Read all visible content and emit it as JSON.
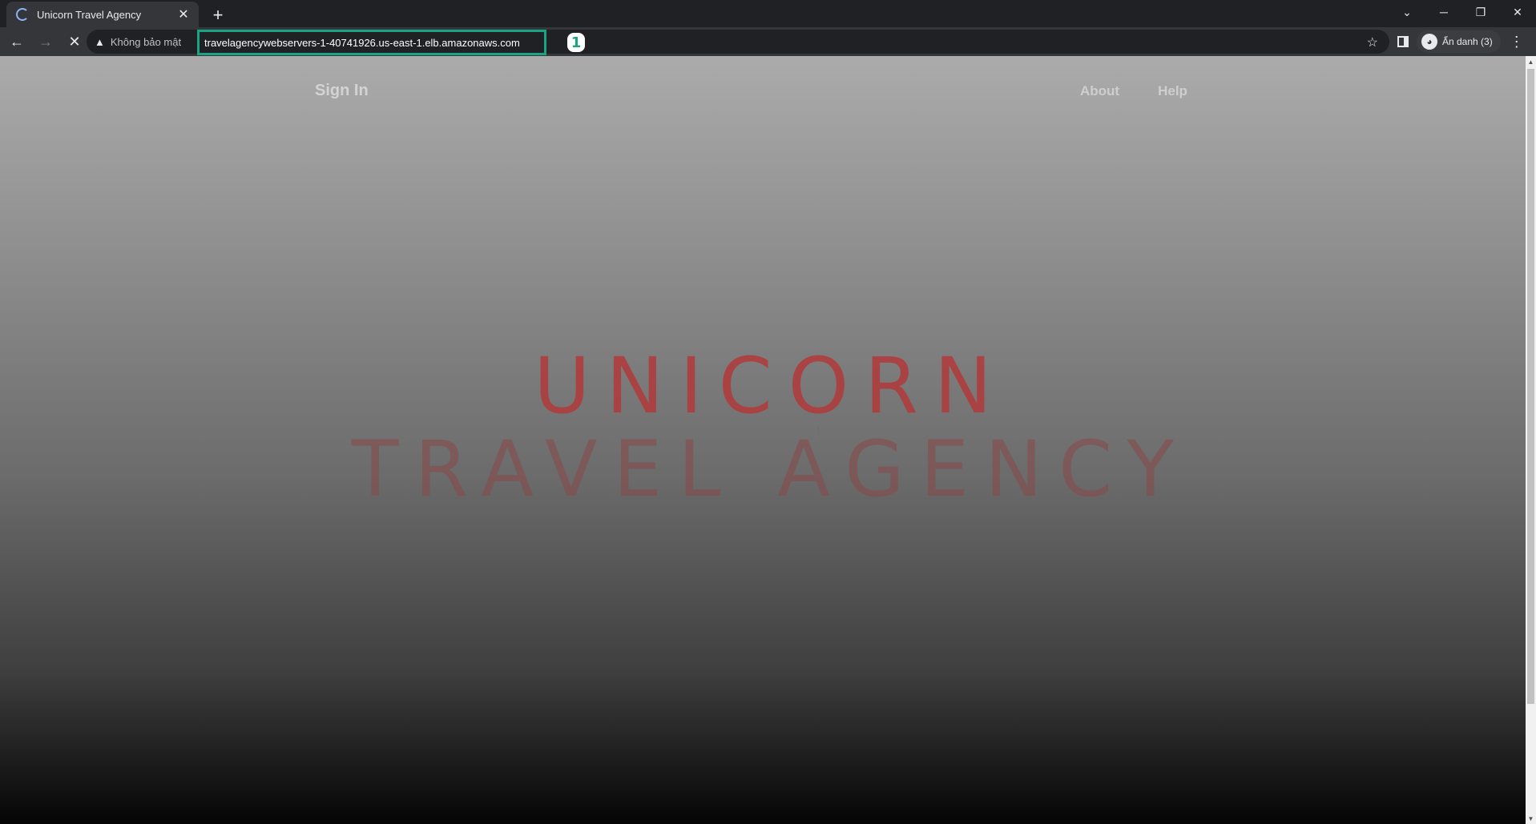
{
  "browser": {
    "tab": {
      "title": "Unicorn Travel Agency",
      "close_icon": "✕"
    },
    "new_tab_icon": "+",
    "window_controls": {
      "tab_search": "⌄",
      "minimize": "─",
      "restore": "❐",
      "close": "✕"
    },
    "toolbar": {
      "back_icon": "←",
      "forward_icon": "→",
      "stop_icon": "✕",
      "security_label": "Không bảo mật",
      "url": "travelagencywebservers-1-40741926.us-east-1.elb.amazonaws.com",
      "annotation_marker": "1",
      "bookmark_icon": "☆",
      "profile_label": "Ẩn danh (3)",
      "menu_icon": "⋮"
    }
  },
  "site": {
    "nav": {
      "sign_in": "Sign In",
      "links": [
        "About",
        "Help"
      ]
    },
    "hero": {
      "line1": "UNICORN",
      "line2": "TRAVEL AGENCY"
    }
  },
  "colors": {
    "accent_annotation": "#1aa385",
    "hero_red": "#b23a3a"
  }
}
